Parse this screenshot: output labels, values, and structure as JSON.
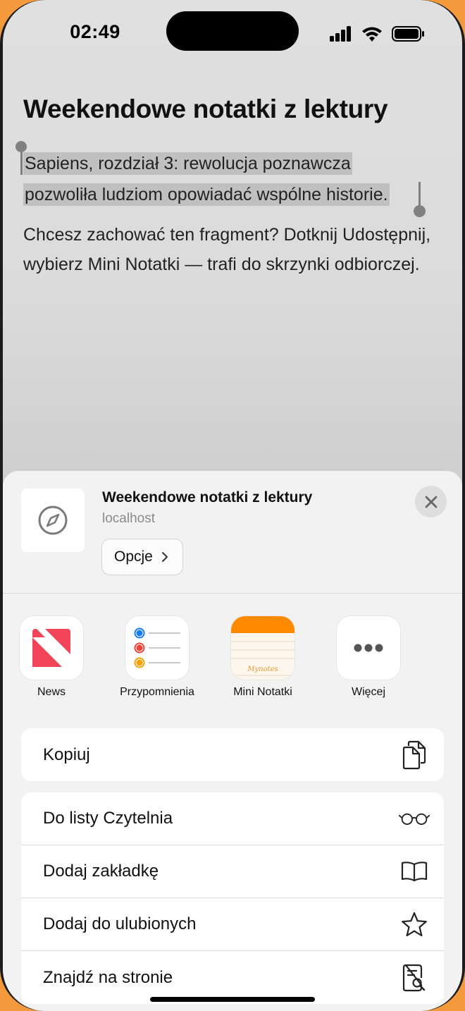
{
  "status_bar": {
    "time": "02:49"
  },
  "page": {
    "title": "Weekendowe notatki z lektury",
    "selected_line_1": "Sapiens, rozdział 3: rewolucja poznawcza",
    "selected_line_2": "pozwoliła ludziom opowiadać wspólne historie.",
    "body": "Chcesz zachować ten fragment? Dotknij Udostępnij, wybierz Mini Notatki — trafi do skrzynki odbiorczej."
  },
  "share_sheet": {
    "title": "Weekendowe notatki z lektury",
    "subtitle": "localhost",
    "options_label": "Opcje",
    "apps": [
      {
        "label": "News",
        "icon": "news-icon"
      },
      {
        "label": "Przypomnienia",
        "icon": "reminders-icon"
      },
      {
        "label": "Mini Notatki",
        "icon": "mini-notes-icon",
        "icon_text": "Mynotes"
      },
      {
        "label": "Więcej",
        "icon": "more-icon"
      }
    ],
    "actions": [
      {
        "label": "Kopiuj",
        "icon": "copy-icon"
      },
      {
        "label": "Do listy Czytelnia",
        "icon": "glasses-icon"
      },
      {
        "label": "Dodaj zakładkę",
        "icon": "book-icon"
      },
      {
        "label": "Dodaj do ulubionych",
        "icon": "star-icon"
      },
      {
        "label": "Znajdź na stronie",
        "icon": "find-on-page-icon"
      }
    ]
  },
  "colors": {
    "background": "#f49a3c",
    "selection": "#c0c0c0",
    "news_red": "#f2455a",
    "notes_orange": "#ff8a00"
  }
}
